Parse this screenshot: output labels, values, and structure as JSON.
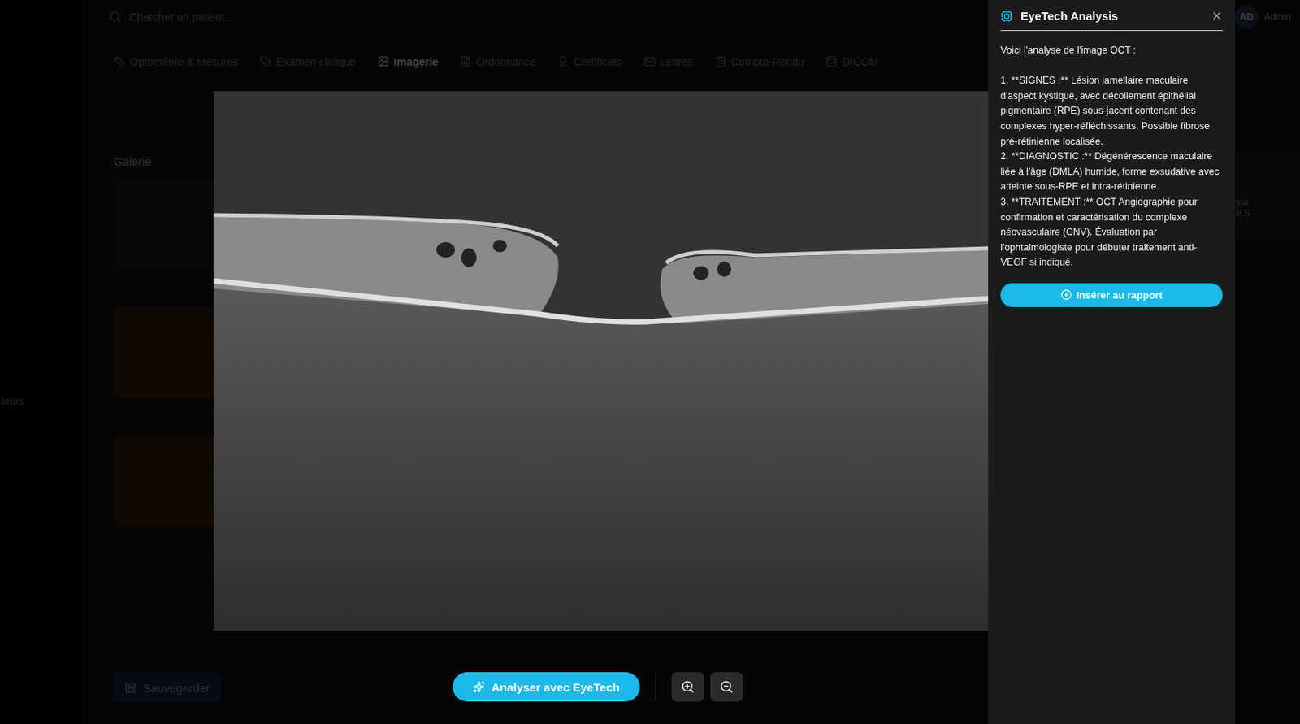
{
  "app": {
    "search_placeholder": "Chercher un patient...",
    "user": {
      "initials": "AD",
      "name": "Admin"
    },
    "sidebar_fragment": "teurs",
    "tabs": [
      {
        "label": "Optométrie & Mesures",
        "selected": false
      },
      {
        "label": "Examen clinique",
        "selected": false
      },
      {
        "label": "Imagerie",
        "selected": true
      },
      {
        "label": "Ordonnance",
        "selected": false
      },
      {
        "label": "Certificats",
        "selected": false
      },
      {
        "label": "Lettres",
        "selected": false
      },
      {
        "label": "Compte-Rendu",
        "selected": false
      },
      {
        "label": "DICOM",
        "selected": false
      }
    ],
    "gallery": {
      "title": "Galerie",
      "thumbnails": [
        {
          "kind": "oct"
        },
        {
          "kind": "oct"
        },
        {
          "kind": "oct"
        },
        {
          "kind": "fundus"
        },
        {
          "kind": "fundus"
        },
        {
          "kind": "oct"
        },
        {
          "kind": "fundus"
        },
        {
          "kind": "fundus"
        },
        {
          "kind": "oct"
        }
      ]
    },
    "save_button": "Sauvegarder",
    "import_card": "IMPORTER APPAREILS"
  },
  "viewer": {
    "analyze_button": "Analyser avec EyeTech"
  },
  "analysis_panel": {
    "title": "EyeTech Analysis",
    "intro": "Voici l'analyse de l'image OCT :",
    "items": [
      "1. **SIGNES :** Lésion lamellaire maculaire d'aspect kystique, avec décollement épithélial pigmentaire (RPE) sous-jacent contenant des complexes hyper-réfléchissants. Possible fibrose pré-rétinienne localisée.",
      "2. **DIAGNOSTIC :** Dégénérescence maculaire liée à l'âge (DMLA) humide, forme exsudative avec atteinte sous-RPE et intra-rétinienne.",
      "3. **TRAITEMENT :** OCT Angiographie pour confirmation et caractérisation du complexe néovasculaire (CNV). Évaluation par l'ophtalmologiste pour débuter traitement anti-VEGF si indiqué."
    ],
    "insert_button": "Insérer au rapport"
  }
}
